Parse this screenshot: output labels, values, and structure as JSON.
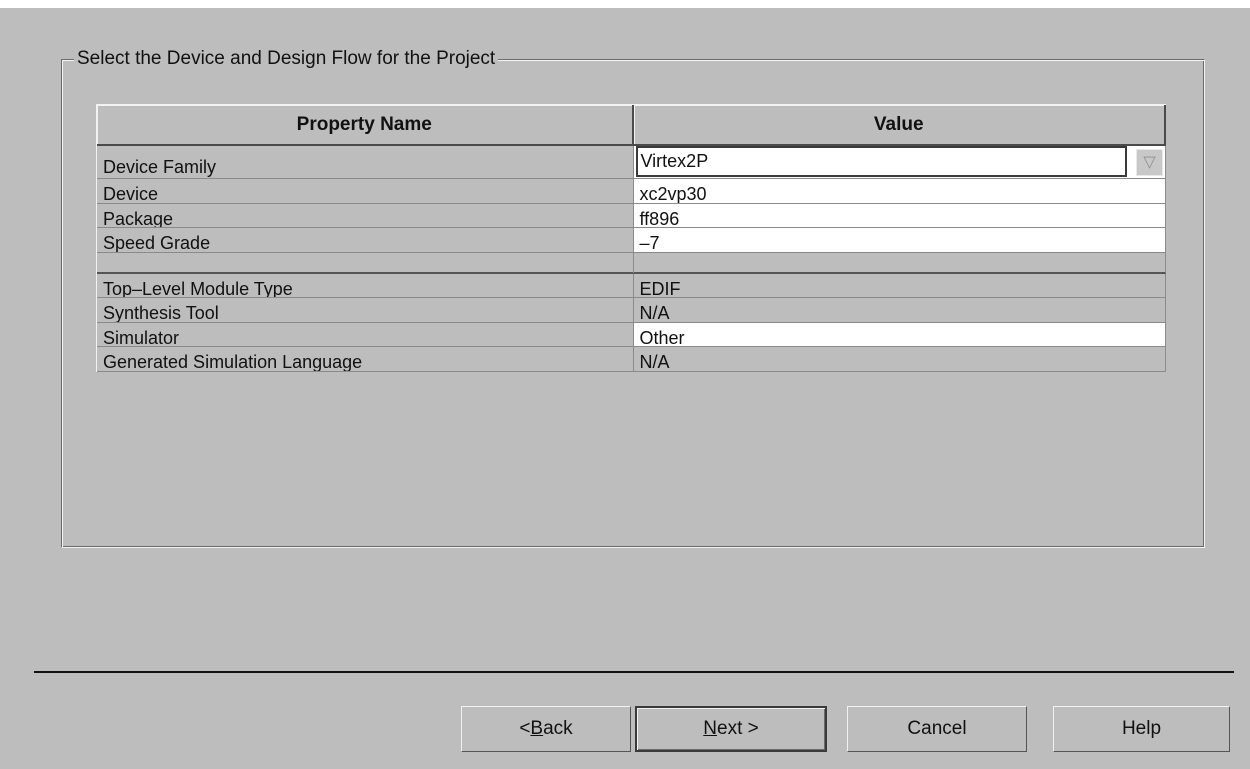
{
  "group": {
    "title": "Select the Device and Design Flow for the Project"
  },
  "table": {
    "headers": [
      "Property Name",
      "Value"
    ],
    "rows": [
      {
        "name": "Device Family",
        "value": "Virtex2P"
      },
      {
        "name": "Device",
        "value": "xc2vp30"
      },
      {
        "name": "Package",
        "value": "ff896"
      },
      {
        "name": "Speed Grade",
        "value": "–7"
      },
      {
        "name": "",
        "value": ""
      },
      {
        "name": "Top–Level Module Type",
        "value": "EDIF"
      },
      {
        "name": "Synthesis Tool",
        "value": "N/A"
      },
      {
        "name": "Simulator",
        "value": "Other"
      },
      {
        "name": "Generated Simulation Language",
        "value": "N/A"
      }
    ],
    "dropdown_icon": "triangle-down"
  },
  "buttons": {
    "back": {
      "prefix": "< ",
      "mnemonic": "B",
      "rest": "ack"
    },
    "next": {
      "prefix": "",
      "mnemonic": "N",
      "rest": "ext >"
    },
    "cancel": "Cancel",
    "help": "Help"
  }
}
